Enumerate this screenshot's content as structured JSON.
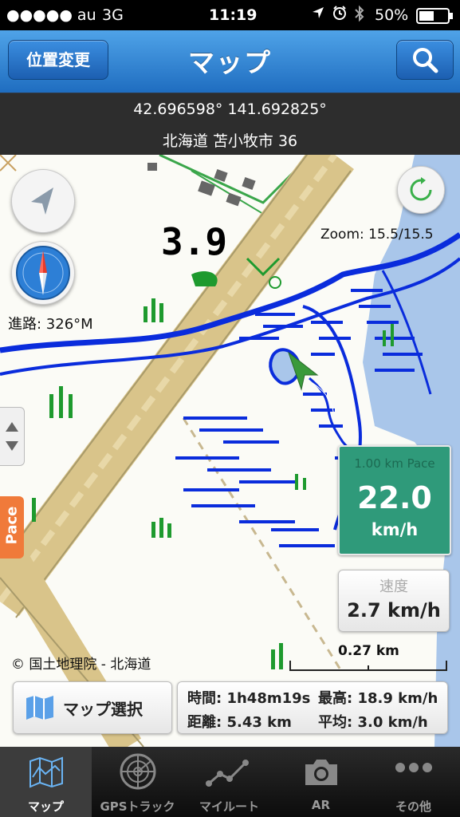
{
  "status_bar": {
    "carrier": "●●●●● au",
    "network": "3G",
    "time": "11:19",
    "battery": "50%"
  },
  "nav": {
    "left_button": "位置変更",
    "title": "マップ",
    "right_icon": "search-icon"
  },
  "location": {
    "coordinates": "42.696598° 141.692825°",
    "address": "北海道 苫小牧市 36"
  },
  "map": {
    "zoom": "Zoom: 15.5/15.5",
    "heading": "進路: 326°M",
    "contour_label": "3.9",
    "copyright": "© 国土地理院 - 北海道",
    "scale": "0.27 km",
    "pace_tab": "Pace"
  },
  "pace_panel": {
    "title": "1.00 km Pace",
    "value": "22.0",
    "unit": "km/h"
  },
  "speed_panel": {
    "title": "速度",
    "value": "2.7 km/h"
  },
  "map_select_button": "マップ選択",
  "stats": {
    "time": "時間: 1h48m19s",
    "max": "最高: 18.9 km/h",
    "distance": "距離: 5.43 km",
    "avg": "平均: 3.0 km/h"
  },
  "tabs": [
    {
      "label": "マップ",
      "icon": "map-icon"
    },
    {
      "label": "GPSトラック",
      "icon": "radar-icon"
    },
    {
      "label": "マイルート",
      "icon": "route-icon"
    },
    {
      "label": "AR",
      "icon": "camera-icon"
    },
    {
      "label": "その他",
      "icon": "more-icon"
    }
  ],
  "colors": {
    "nav_blue": "#2b7fd4",
    "pace_green": "#2f9a7a",
    "water_blue": "#0a2cdc",
    "road_tan": "#d9c48a",
    "sea_blue": "#a9c6ea"
  }
}
